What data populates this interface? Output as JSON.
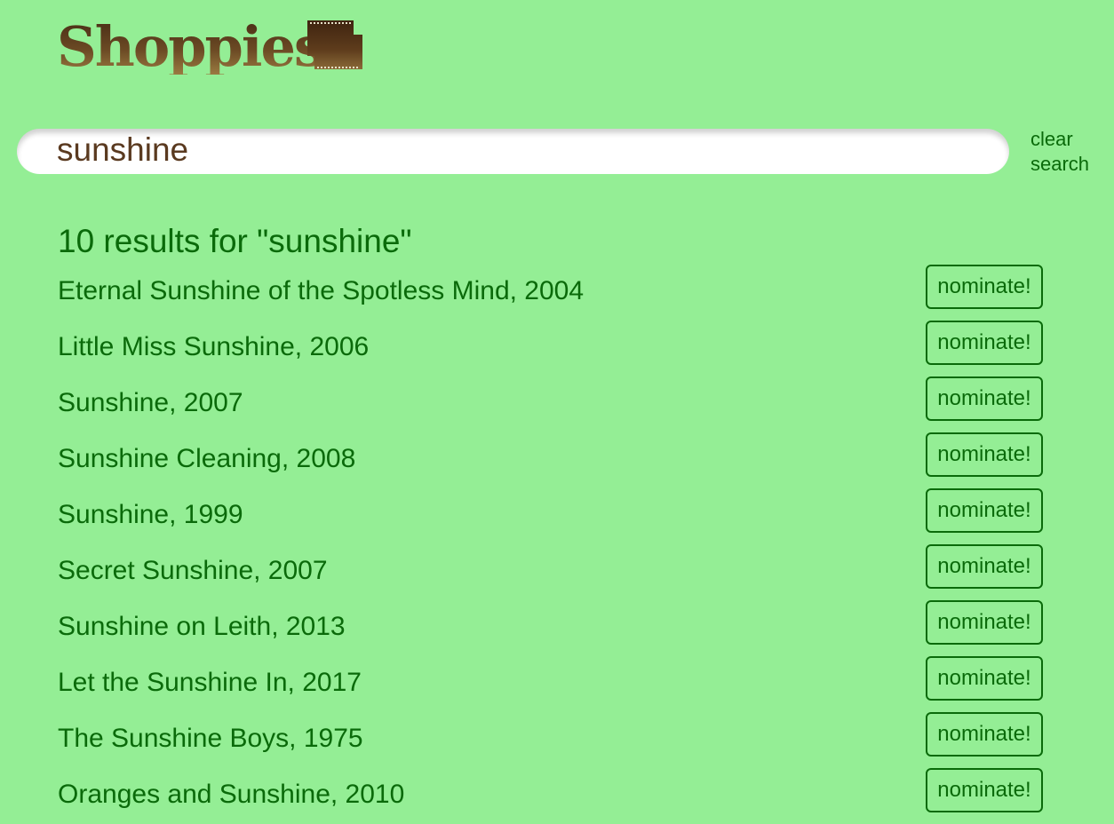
{
  "header": {
    "logo_text": "Shoppies",
    "logo_icon": "film-reel-icon",
    "brand_colors": {
      "logo_dark": "#4a2e16",
      "logo_light": "#9a7a40"
    }
  },
  "search": {
    "value": "sunshine",
    "placeholder": "",
    "clear_label_line1": "clear",
    "clear_label_line2": "search"
  },
  "results": {
    "heading": "10 results for \"sunshine\"",
    "nominate_label": "nominate!",
    "items": [
      {
        "title": "Eternal Sunshine of the Spotless Mind, 2004",
        "button": "nominate!"
      },
      {
        "title": "Little Miss Sunshine, 2006",
        "button": "nominate!"
      },
      {
        "title": "Sunshine, 2007",
        "button": "nominate!"
      },
      {
        "title": "Sunshine Cleaning, 2008",
        "button": "nominate!"
      },
      {
        "title": "Sunshine, 1999",
        "button": "nominate!"
      },
      {
        "title": "Secret Sunshine, 2007",
        "button": "nominate!"
      },
      {
        "title": "Sunshine on Leith, 2013",
        "button": "nominate!"
      },
      {
        "title": "Let the Sunshine In, 2017",
        "button": "nominate!"
      },
      {
        "title": "The Sunshine Boys, 1975",
        "button": "nominate!"
      },
      {
        "title": "Oranges and Sunshine, 2010",
        "button": "nominate!"
      }
    ]
  },
  "colors": {
    "background": "#94ee95",
    "text_green": "#0a6a0a",
    "search_text": "#5a3a20"
  }
}
